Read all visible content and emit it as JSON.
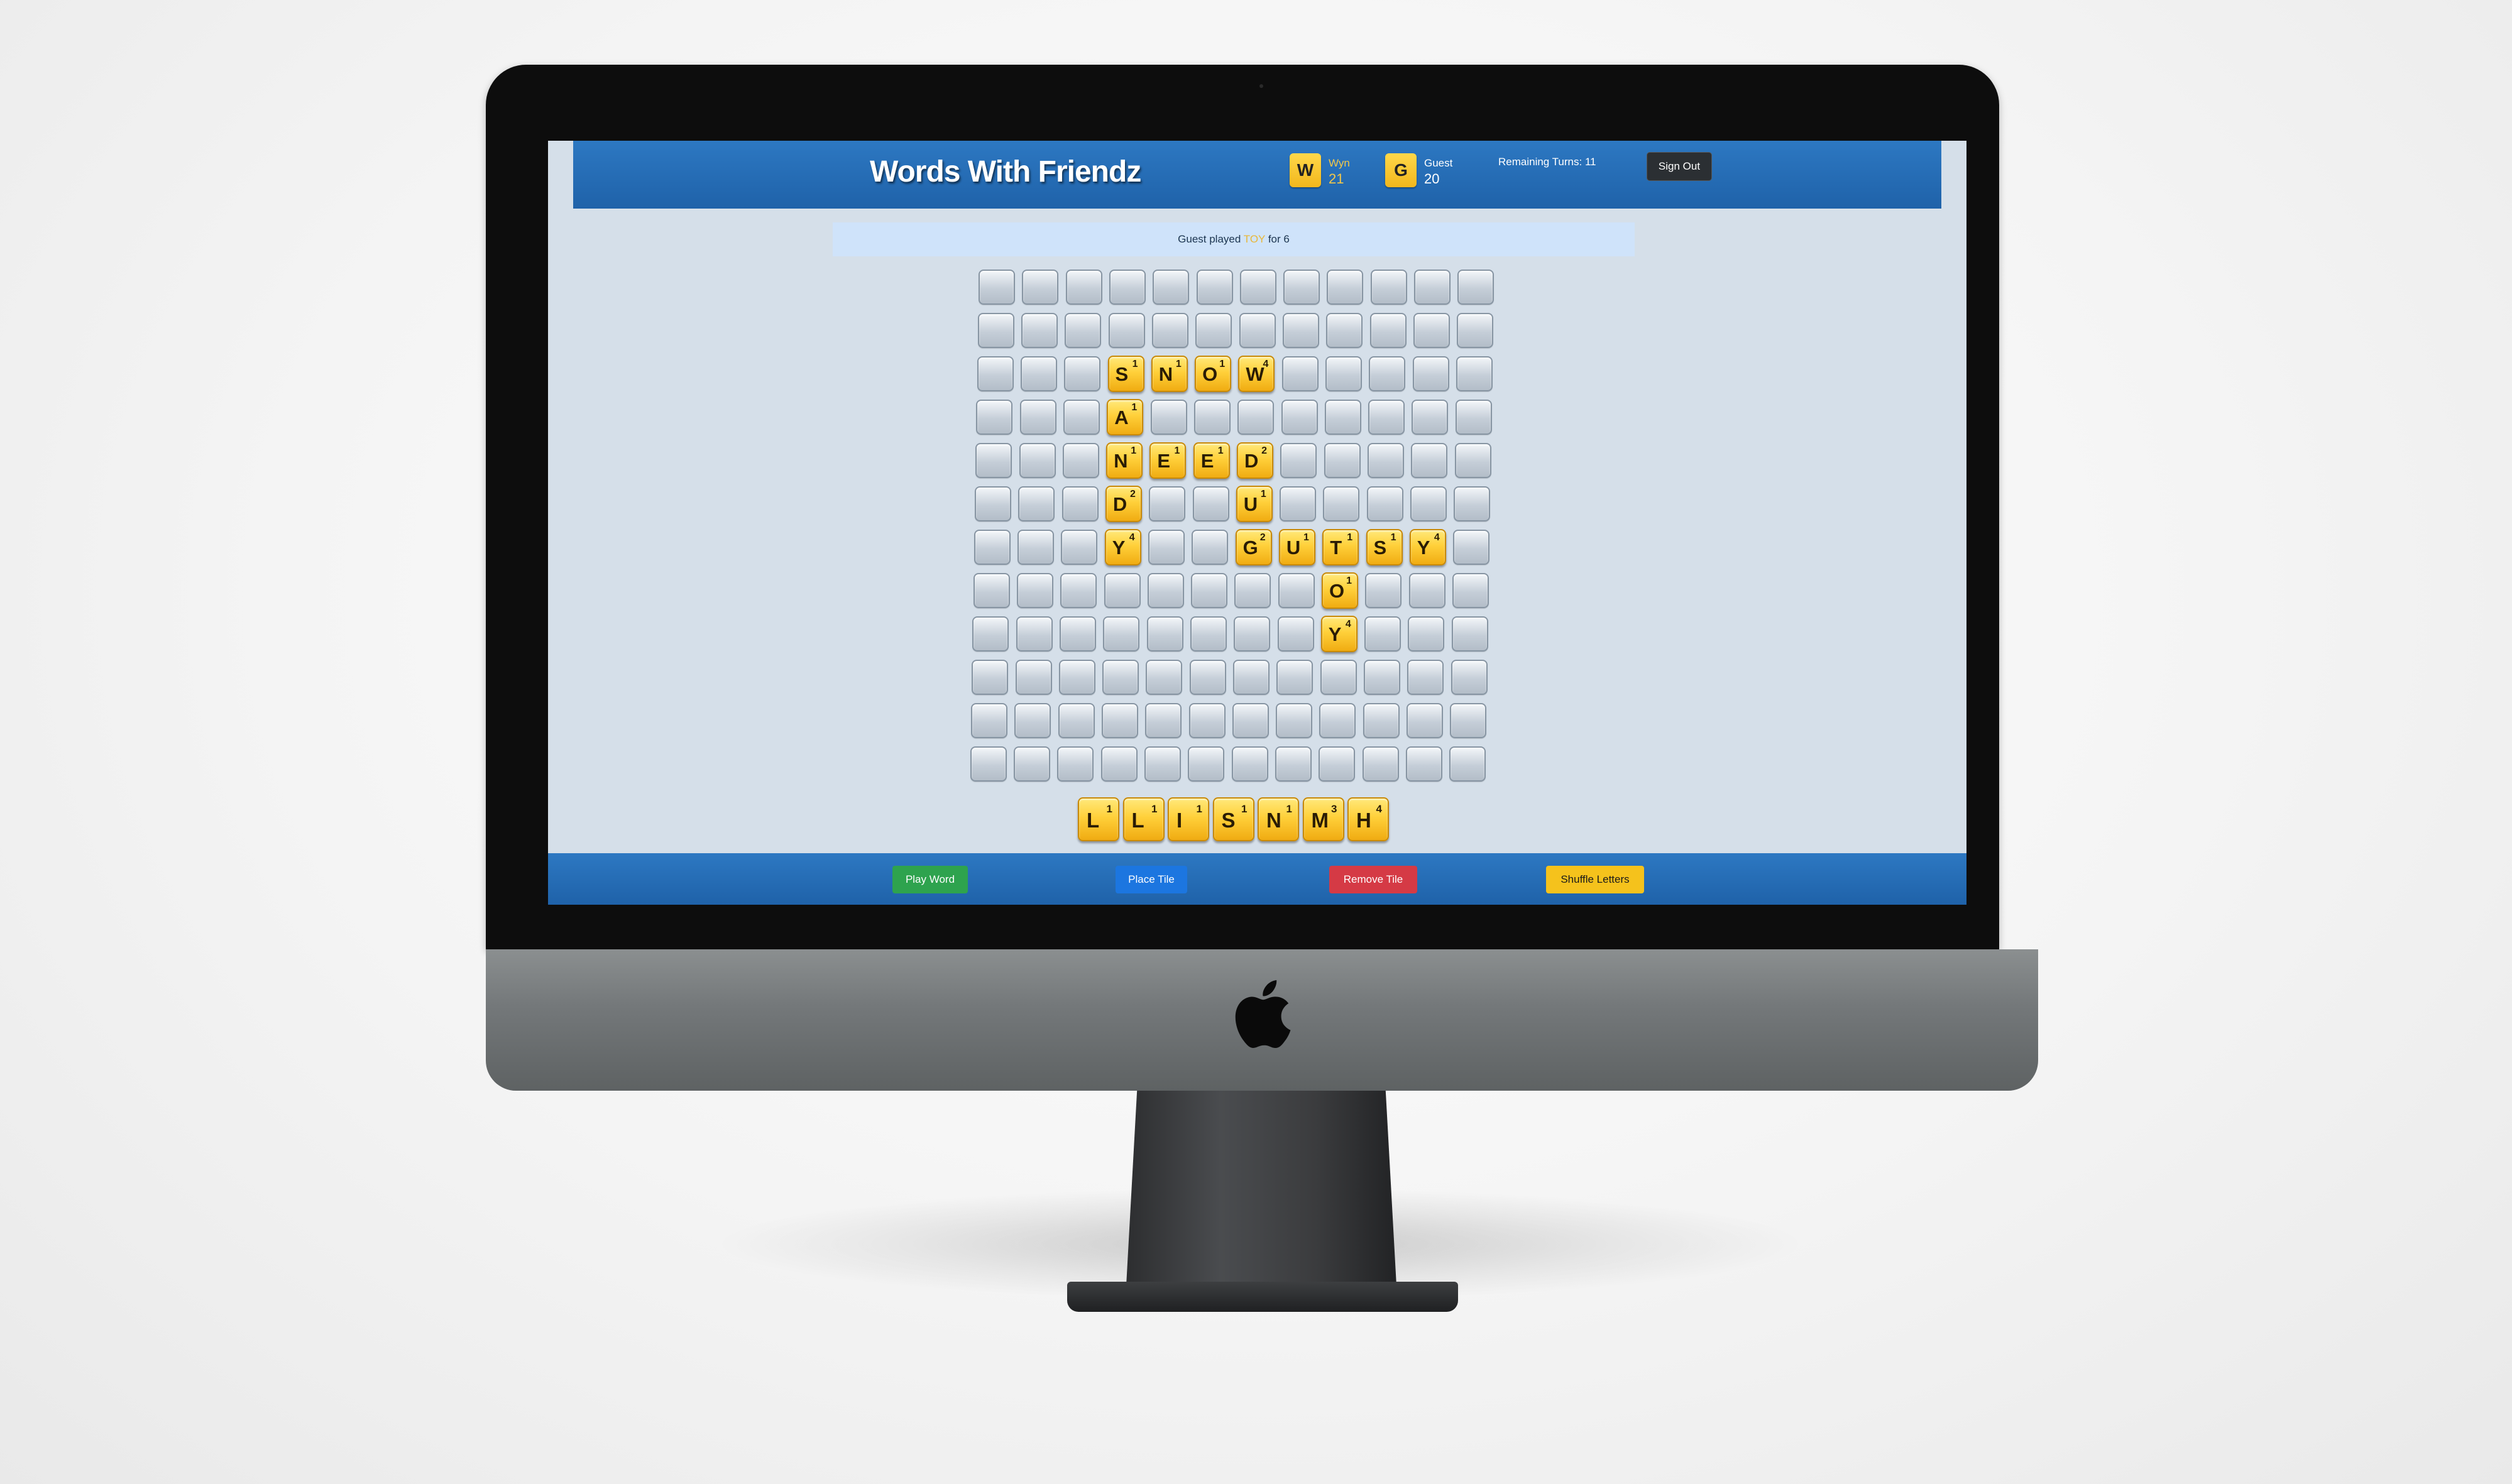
{
  "app": {
    "title": "Words With Friendz"
  },
  "players": [
    {
      "initial": "W",
      "name": "Wyn",
      "score": "21"
    },
    {
      "initial": "G",
      "name": "Guest",
      "score": "20"
    }
  ],
  "remaining_turns": "Remaining Turns: 11",
  "sign_out_label": "Sign Out",
  "status": {
    "prefix": "Guest played",
    "word": "TOY",
    "suffix": "for 6"
  },
  "board": {
    "rows": 12,
    "cols": 12,
    "tiles": [
      {
        "r": 2,
        "c": 3,
        "l": "S",
        "p": "1"
      },
      {
        "r": 2,
        "c": 4,
        "l": "N",
        "p": "1"
      },
      {
        "r": 2,
        "c": 5,
        "l": "O",
        "p": "1"
      },
      {
        "r": 2,
        "c": 6,
        "l": "W",
        "p": "4"
      },
      {
        "r": 3,
        "c": 3,
        "l": "A",
        "p": "1"
      },
      {
        "r": 4,
        "c": 3,
        "l": "N",
        "p": "1"
      },
      {
        "r": 4,
        "c": 4,
        "l": "E",
        "p": "1"
      },
      {
        "r": 4,
        "c": 5,
        "l": "E",
        "p": "1"
      },
      {
        "r": 4,
        "c": 6,
        "l": "D",
        "p": "2"
      },
      {
        "r": 5,
        "c": 3,
        "l": "D",
        "p": "2"
      },
      {
        "r": 5,
        "c": 6,
        "l": "U",
        "p": "1"
      },
      {
        "r": 6,
        "c": 3,
        "l": "Y",
        "p": "4"
      },
      {
        "r": 6,
        "c": 6,
        "l": "G",
        "p": "2"
      },
      {
        "r": 6,
        "c": 7,
        "l": "U",
        "p": "1"
      },
      {
        "r": 6,
        "c": 8,
        "l": "T",
        "p": "1"
      },
      {
        "r": 6,
        "c": 9,
        "l": "S",
        "p": "1"
      },
      {
        "r": 6,
        "c": 10,
        "l": "Y",
        "p": "4"
      },
      {
        "r": 7,
        "c": 8,
        "l": "O",
        "p": "1"
      },
      {
        "r": 8,
        "c": 8,
        "l": "Y",
        "p": "4"
      }
    ]
  },
  "rack": [
    {
      "l": "L",
      "p": "1"
    },
    {
      "l": "L",
      "p": "1"
    },
    {
      "l": "I",
      "p": "1"
    },
    {
      "l": "S",
      "p": "1"
    },
    {
      "l": "N",
      "p": "1"
    },
    {
      "l": "M",
      "p": "3"
    },
    {
      "l": "H",
      "p": "4"
    }
  ],
  "actions": {
    "play_word": "Play Word",
    "place_tile": "Place Tile",
    "remove_tile": "Remove Tile",
    "shuffle_letters": "Shuffle Letters"
  },
  "icons": {
    "brand_logo": "apple-logo-icon"
  }
}
